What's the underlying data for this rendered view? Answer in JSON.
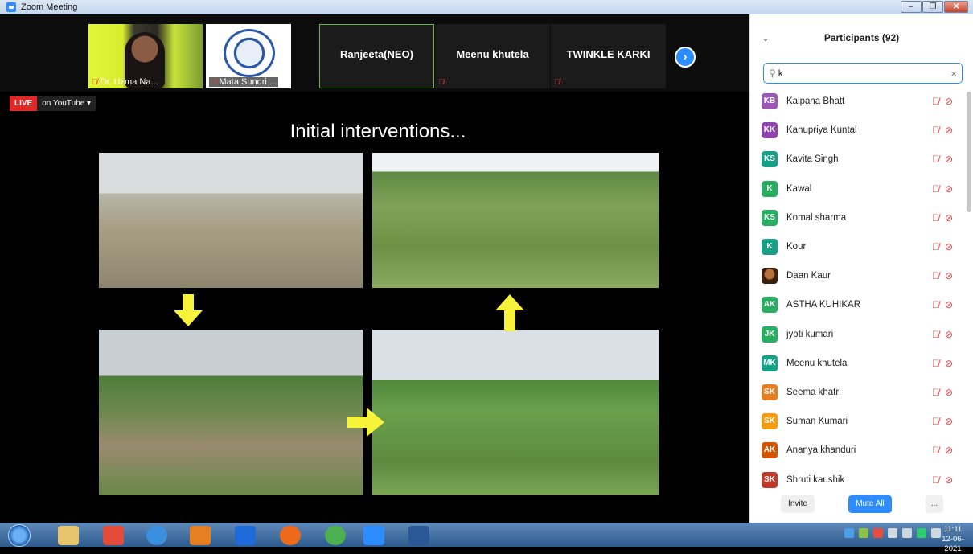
{
  "window": {
    "title": "Zoom Meeting"
  },
  "thumbnails": [
    {
      "name": "Dr. Uzma Na...",
      "muted": true
    },
    {
      "name": "Mata Sundri ...",
      "muted": true
    },
    {
      "name": "Ranjeeta(NEO)",
      "muted": false
    },
    {
      "name": "Meenu khutela",
      "muted": true
    },
    {
      "name": "TWINKLE KARKI",
      "muted": true
    }
  ],
  "live": {
    "tag": "LIVE",
    "platform": "on YouTube ▾"
  },
  "slide": {
    "title": "Initial interventions..."
  },
  "panel": {
    "title": "Participants (92)",
    "search_value": "k",
    "buttons": {
      "invite": "Invite",
      "mute_all": "Mute All",
      "more": "..."
    },
    "participants": [
      {
        "initials": "KB",
        "name": "Kalpana Bhatt",
        "color": "#9b59b6"
      },
      {
        "initials": "KK",
        "name": "Kanupriya Kuntal",
        "color": "#8e44ad"
      },
      {
        "initials": "KS",
        "name": "Kavita Singh",
        "color": "#16a085"
      },
      {
        "initials": "K",
        "name": "Kawal",
        "color": "#27ae60"
      },
      {
        "initials": "KS",
        "name": "Komal sharma",
        "color": "#27ae60"
      },
      {
        "initials": "K",
        "name": "Kour",
        "color": "#16a085"
      },
      {
        "initials": "",
        "name": "Daan Kaur",
        "color": "photo"
      },
      {
        "initials": "AK",
        "name": "ASTHA KUHIKAR",
        "color": "#27ae60"
      },
      {
        "initials": "JK",
        "name": "jyoti kumari",
        "color": "#27ae60"
      },
      {
        "initials": "MK",
        "name": "Meenu khutela",
        "color": "#16a085"
      },
      {
        "initials": "SK",
        "name": "Seema khatri",
        "color": "#e67e22"
      },
      {
        "initials": "SK",
        "name": "Suman Kumari",
        "color": "#f39c12"
      },
      {
        "initials": "AK",
        "name": "Ananya khanduri",
        "color": "#d35400"
      },
      {
        "initials": "SK",
        "name": "Shruti kaushik",
        "color": "#c0392b"
      }
    ]
  },
  "taskbar": {
    "time": "11:11",
    "date": "12-06-2021"
  }
}
